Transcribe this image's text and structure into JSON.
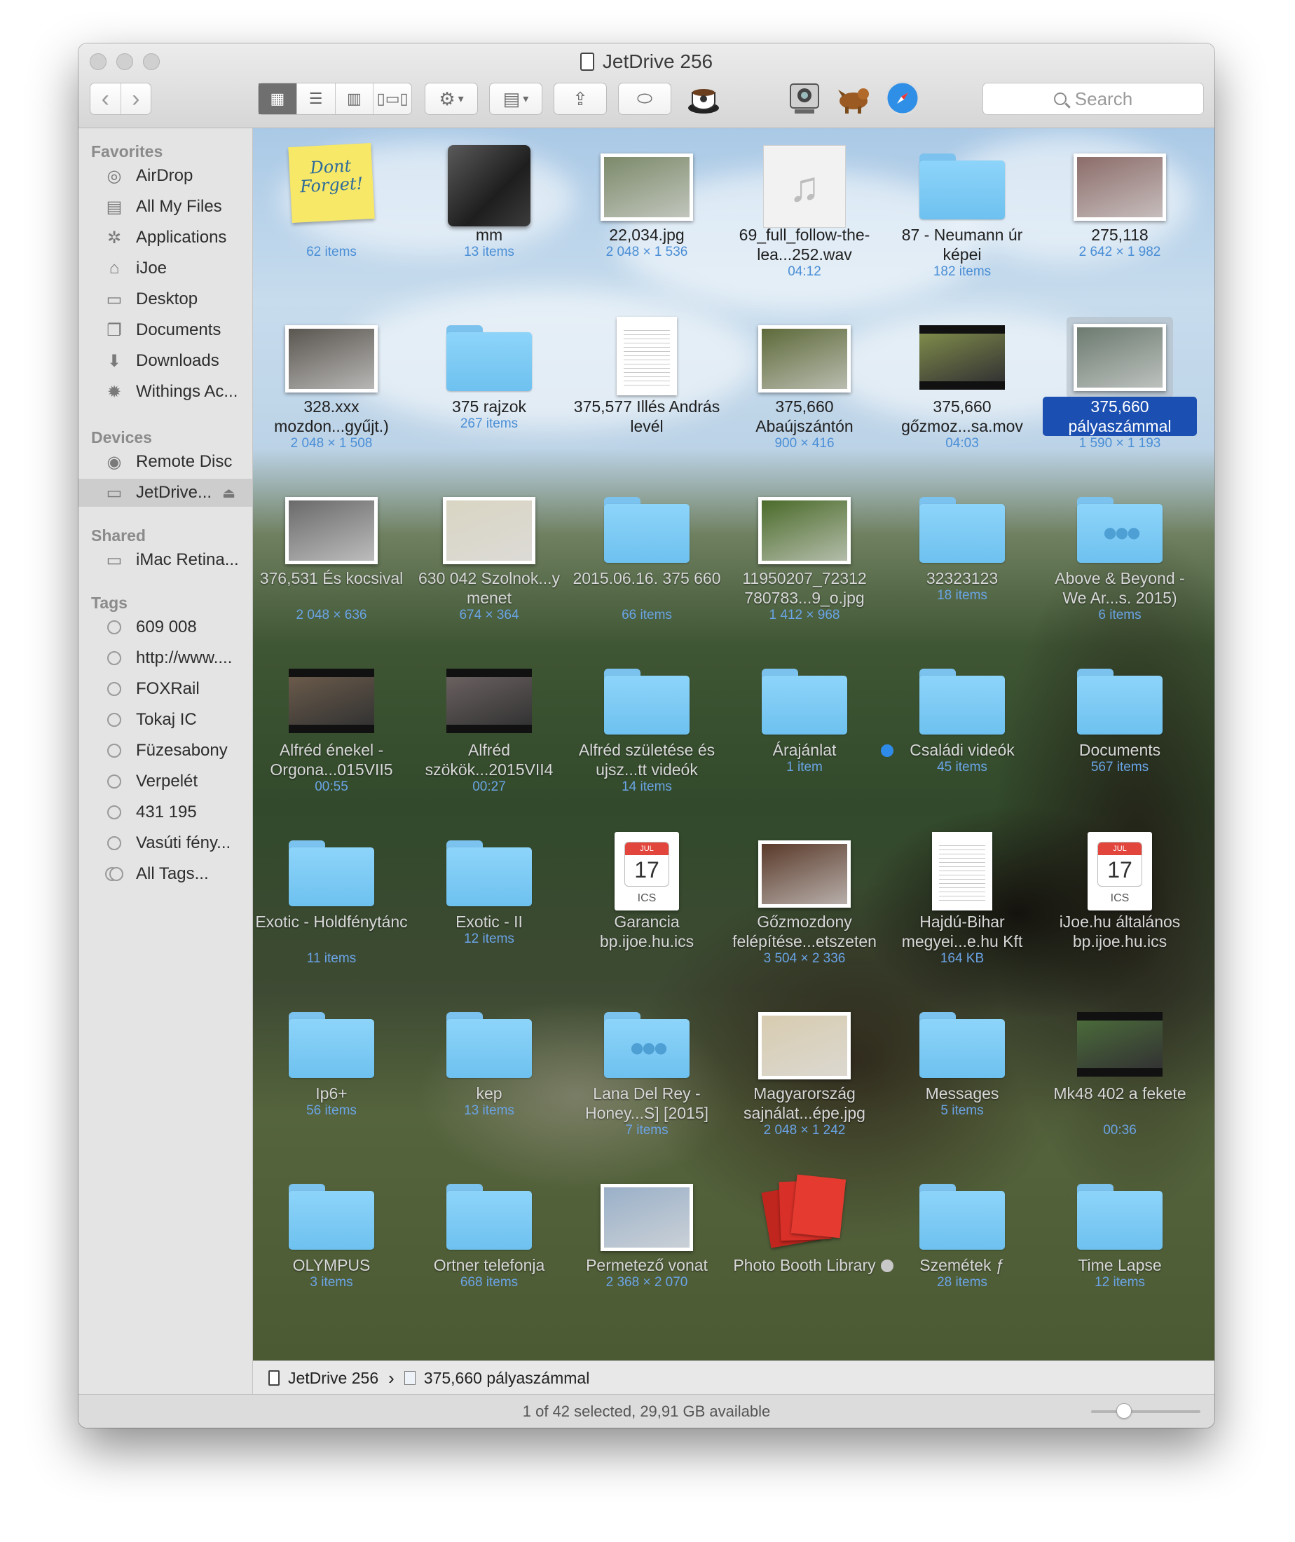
{
  "window": {
    "title": "JetDrive 256"
  },
  "toolbar": {
    "back": "‹",
    "forward": "›",
    "view_modes": [
      "icon",
      "list",
      "column",
      "cover-flow"
    ],
    "action_icon": "gear-icon",
    "arrange_icon": "arrange-icon",
    "share_icon": "share-icon",
    "tag_icon": "tag-icon",
    "search_placeholder": "Search"
  },
  "sidebar": {
    "favorites_header": "Favorites",
    "favorites": [
      {
        "label": "AirDrop",
        "icon": "airdrop-icon",
        "glyph": "◎"
      },
      {
        "label": "All My Files",
        "icon": "all-files-icon",
        "glyph": "▤"
      },
      {
        "label": "Applications",
        "icon": "applications-icon",
        "glyph": "✲"
      },
      {
        "label": "iJoe",
        "icon": "home-icon",
        "glyph": "⌂"
      },
      {
        "label": "Desktop",
        "icon": "desktop-icon",
        "glyph": "▭"
      },
      {
        "label": "Documents",
        "icon": "documents-icon",
        "glyph": "❐"
      },
      {
        "label": "Downloads",
        "icon": "downloads-icon",
        "glyph": "⬇"
      },
      {
        "label": "Withings Ac...",
        "icon": "gear-icon",
        "glyph": "✹"
      }
    ],
    "devices_header": "Devices",
    "devices": [
      {
        "label": "Remote Disc",
        "icon": "disc-icon",
        "glyph": "◉"
      },
      {
        "label": "JetDrive...",
        "icon": "drive-icon",
        "glyph": "▭",
        "eject": "⏏",
        "selected": true
      }
    ],
    "shared_header": "Shared",
    "shared": [
      {
        "label": "iMac Retina...",
        "icon": "computer-icon",
        "glyph": "▭"
      }
    ],
    "tags_header": "Tags",
    "tags": [
      "609 008",
      "http://www....",
      "FOXRail",
      "Tokaj IC",
      "Füzesabony",
      "Verpelét",
      "431 195",
      "Vasúti fény...",
      "All Tags..."
    ]
  },
  "items": [
    {
      "name": "Dont Forget!",
      "label": "",
      "sub": "62 items",
      "kind": "sticky"
    },
    {
      "name": "mm",
      "sub": "13 items",
      "kind": "blackfolder"
    },
    {
      "name": "22,034.jpg",
      "sub": "2 048 × 1 536",
      "kind": "photo",
      "color": "#7c8a6a"
    },
    {
      "name": "69_full_follow-the-lea...252.wav",
      "sub": "04:12",
      "kind": "audio"
    },
    {
      "name": "87 - Neumann úr képei",
      "sub": "182 items",
      "kind": "folder"
    },
    {
      "name": "275,118",
      "sub": "2 642 × 1 982",
      "kind": "photo",
      "color": "#8c6d6a"
    },
    {
      "name": "328.xxx mozdon...gyűjt.)",
      "sub": "2 048 × 1 508",
      "kind": "photo",
      "color": "#5a5650"
    },
    {
      "name": "375 rajzok",
      "sub": "267 items",
      "kind": "folder"
    },
    {
      "name": "375,577 Illés András levél",
      "sub": "",
      "kind": "doc"
    },
    {
      "name": "375,660 Abaújszántón",
      "sub": "900 × 416",
      "kind": "photo",
      "color": "#5e6a3a"
    },
    {
      "name": "375,660 gőzmoz...sa.mov",
      "sub": "04:03",
      "kind": "video",
      "color": "#7e8a4a"
    },
    {
      "name": "375,660 pályaszámmal",
      "sub": "1 590 × 1 193",
      "kind": "photo",
      "color": "#6c7b70",
      "selected": true
    },
    {
      "name": "376,531 És kocsival",
      "sub": "2 048 × 636",
      "kind": "photo",
      "color": "#6a6a6a"
    },
    {
      "name": "630 042 Szolnok...y menet",
      "sub": "674 × 364",
      "kind": "photo",
      "color": "#d9d5c3"
    },
    {
      "name": "2015.06.16. 375 660",
      "sub": "66 items",
      "kind": "folder"
    },
    {
      "name": "11950207_72312 780783...9_o.jpg",
      "sub": "1 412 × 968",
      "kind": "photo",
      "color": "#4b6b2a"
    },
    {
      "name": "32323123",
      "sub": "18 items",
      "kind": "folder"
    },
    {
      "name": "Above & Beyond - We Ar...s. 2015)",
      "sub": "6 items",
      "kind": "folder",
      "mark": "👥"
    },
    {
      "name": "Alfréd énekel - Orgona...015VII5",
      "sub": "00:55",
      "kind": "video",
      "color": "#6a5a4a"
    },
    {
      "name": "Alfréd szökök...2015VII4",
      "sub": "00:27",
      "kind": "video",
      "color": "#6a6060"
    },
    {
      "name": "Alfréd születése és ujsz...tt videók",
      "sub": "14 items",
      "kind": "folder"
    },
    {
      "name": "Árajánlat",
      "sub": "1 item",
      "kind": "folder"
    },
    {
      "name": "Családi videók",
      "sub": "45 items",
      "kind": "folder",
      "dot": "#2f8bea"
    },
    {
      "name": "Documents",
      "sub": "567 items",
      "kind": "folder"
    },
    {
      "name": "Exotic - Holdfénytánc",
      "sub": "11 items",
      "kind": "folder"
    },
    {
      "name": "Exotic - II",
      "sub": "12 items",
      "kind": "folder"
    },
    {
      "name": "Garancia bp.ijoe.hu.ics",
      "sub": "",
      "kind": "ics",
      "month": "JUL",
      "day": "17"
    },
    {
      "name": "Gőzmozdony felépítése...etszeten",
      "sub": "3 504 × 2 336",
      "kind": "photo",
      "color": "#5a3a2a"
    },
    {
      "name": "Hajdú-Bihar megyei...e.hu Kft",
      "sub": "164 KB",
      "kind": "doc"
    },
    {
      "name": "iJoe.hu általános bp.ijoe.hu.ics",
      "sub": "",
      "kind": "ics",
      "month": "JUL",
      "day": "17"
    },
    {
      "name": "Ip6+",
      "sub": "56 items",
      "kind": "folder"
    },
    {
      "name": "kep",
      "sub": "13 items",
      "kind": "folder"
    },
    {
      "name": "Lana Del Rey - Honey...S] [2015]",
      "sub": "7 items",
      "kind": "folder",
      "mark": "👥"
    },
    {
      "name": "Magyarország sajnálat...épe.jpg",
      "sub": "2 048 × 1 242",
      "kind": "photo",
      "color": "#d8ccb0"
    },
    {
      "name": "Messages",
      "sub": "5 items",
      "kind": "folder"
    },
    {
      "name": "Mk48 402 a fekete",
      "sub": "00:36",
      "kind": "video",
      "color": "#4a6a3a"
    },
    {
      "name": "OLYMPUS",
      "sub": "3 items",
      "kind": "folder"
    },
    {
      "name": "Ortner telefonja",
      "sub": "668 items",
      "kind": "folder"
    },
    {
      "name": "Permetező vonat",
      "sub": "2 368 × 2 070",
      "kind": "photo",
      "color": "#9ab0c8"
    },
    {
      "name": "Photo Booth Library",
      "sub": "",
      "kind": "photobooth"
    },
    {
      "name": "Szemétek ƒ",
      "sub": "28 items",
      "kind": "folder",
      "dot": "#c8c8c8"
    },
    {
      "name": "Time Lapse",
      "sub": "12 items",
      "kind": "folder"
    }
  ],
  "pathbar": {
    "root": "JetDrive 256",
    "sep": "›",
    "leaf": "375,660 pályaszámmal"
  },
  "status": {
    "text": "1 of 42 selected, 29,91 GB available",
    "icon_size_level": 0.3
  }
}
